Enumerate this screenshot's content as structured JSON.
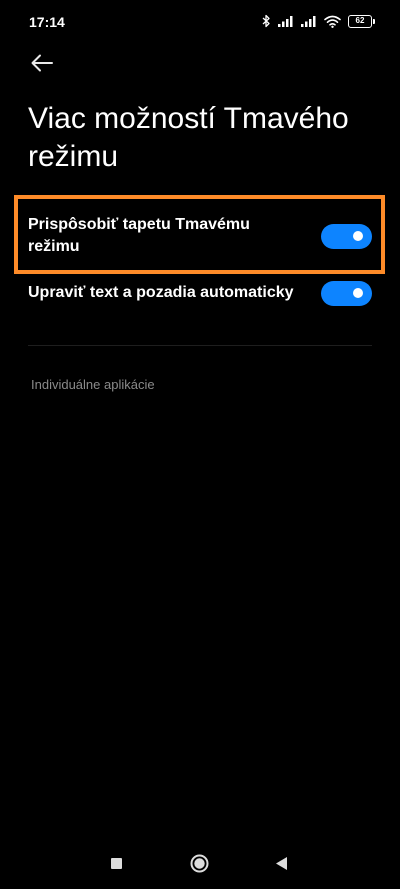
{
  "status_bar": {
    "time": "17:14",
    "battery_level": "62",
    "icons": [
      "bluetooth-icon",
      "signal-icon",
      "signal-icon",
      "wifi-icon",
      "battery-icon"
    ]
  },
  "header": {
    "back_icon": "arrow-left-icon",
    "title": "Viac možností Tmavého režimu"
  },
  "settings": {
    "items": [
      {
        "label": "Prispôsobiť tapetu Tmavému režimu",
        "enabled": true
      },
      {
        "label": "Upraviť text a pozadia automaticky",
        "enabled": true
      }
    ]
  },
  "sections": {
    "individual_apps": "Individuálne aplikácie"
  },
  "navigation": {
    "recents_icon": "square-icon",
    "home_icon": "circle-icon",
    "back_icon": "triangle-back-icon"
  },
  "colors": {
    "background": "#000000",
    "toggle_on": "#0d84ff",
    "highlight": "#fe8b28",
    "secondary_text": "#8a8a8a"
  }
}
